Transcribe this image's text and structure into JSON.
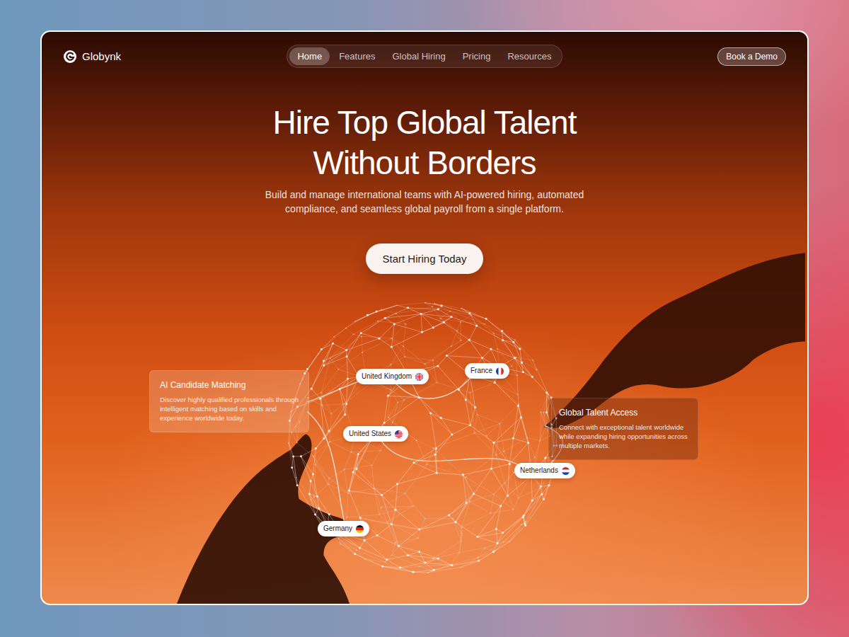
{
  "brand": {
    "name": "Globynk"
  },
  "nav": [
    {
      "label": "Home",
      "selected": true
    },
    {
      "label": "Features",
      "selected": false
    },
    {
      "label": "Global Hiring",
      "selected": false
    },
    {
      "label": "Pricing",
      "selected": false
    },
    {
      "label": "Resources",
      "selected": false
    }
  ],
  "header_button": "Book a Demo",
  "hero": {
    "title_lines": [
      "Hire Top Global Talent",
      "Without Borders"
    ],
    "subtitle_lines": [
      "Build and manage international teams with AI-powered hiring, automated",
      "compliance, and seamless global payroll from a single platform."
    ],
    "button": "Start Hiring Today"
  },
  "features": [
    {
      "title": "AI Candidate Matching",
      "description": "Discover highly qualified professionals through intelligent matching based on skills and experience worldwide today."
    },
    {
      "title": "Global Talent Access",
      "description": "Connect with exceptional talent worldwide while expanding hiring opportunities across multiple markets."
    }
  ],
  "countries": [
    "United Kingdom",
    "France",
    "United States",
    "Netherlands",
    "Germany"
  ]
}
